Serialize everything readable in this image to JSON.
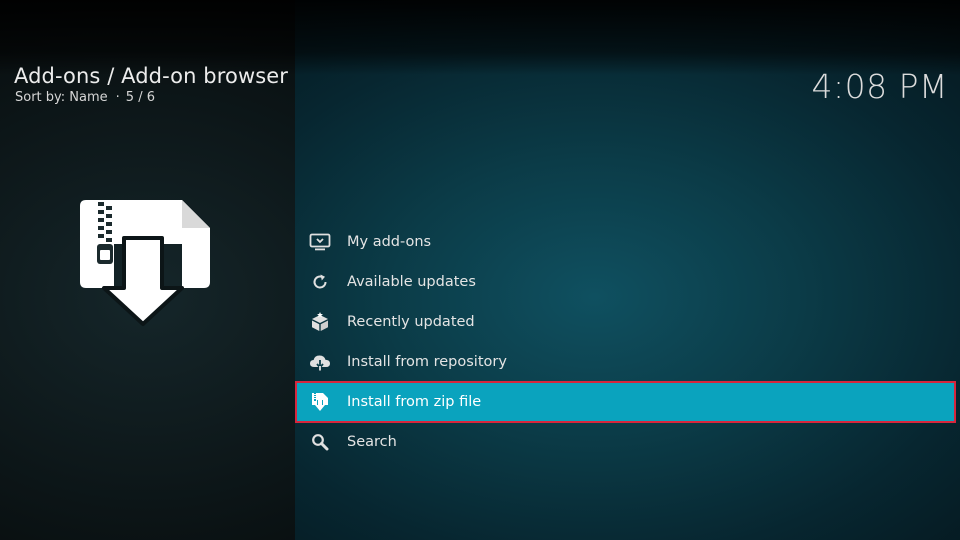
{
  "header": {
    "title": "Add-ons / Add-on browser",
    "sort_label": "Sort by: Name",
    "position": "5 / 6",
    "clock": "4:08 PM"
  },
  "artwork": {
    "icon": "zip-install-icon"
  },
  "menu": {
    "focused_index": 4,
    "items": [
      {
        "label": "My add-ons",
        "icon": "monitor-box-icon"
      },
      {
        "label": "Available updates",
        "icon": "refresh-icon"
      },
      {
        "label": "Recently updated",
        "icon": "box-star-icon"
      },
      {
        "label": "Install from repository",
        "icon": "cloud-download-icon"
      },
      {
        "label": "Install from zip file",
        "icon": "zip-file-icon"
      },
      {
        "label": "Search",
        "icon": "magnifier-icon"
      }
    ]
  },
  "colors": {
    "focus_bg": "#0aa3be",
    "focus_outline": "#d7263d",
    "panel_bg": "#0b3b47"
  }
}
